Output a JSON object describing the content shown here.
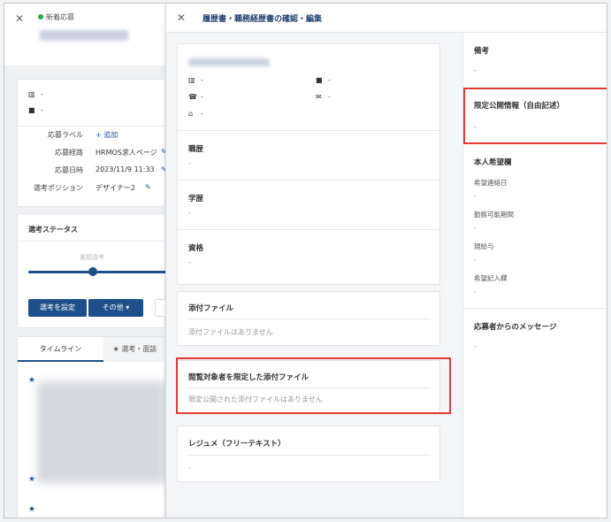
{
  "left_panel": {
    "new_label": "新着応募",
    "new_color": "#2eaa4a",
    "company": "-",
    "job": "-",
    "fields": [
      {
        "label": "応募ラベル",
        "value": "+ 追加"
      },
      {
        "label": "応募経路",
        "value": "HRMOS求人ページ"
      },
      {
        "label": "応募日時",
        "value": "2023/11/9 11:33"
      },
      {
        "label": "選考ポジション",
        "value": "デザイナー2"
      }
    ],
    "status_title": "選考ステータス",
    "stage_label": "書類選考",
    "set_stage_button": "選考を設定",
    "other_button": "その他",
    "timeline_tab": "タイムライン",
    "review_tab": "選考・面談"
  },
  "modal": {
    "title": "履歴書・職務経歴書の確認・編集",
    "contact": {
      "company": "-",
      "job": "-",
      "phone": "-",
      "email": "-",
      "address": "-"
    },
    "sections": [
      {
        "title": "職歴",
        "value": "-"
      },
      {
        "title": "学歴",
        "value": "-"
      },
      {
        "title": "資格",
        "value": "-"
      }
    ],
    "attachments": {
      "title": "添付ファイル",
      "empty": "添付ファイルはありません"
    },
    "restricted": {
      "title": "閲覧対象者を限定した添付ファイル",
      "empty": "限定公開された添付ファイルはありません"
    },
    "resume": {
      "title": "レジュメ（フリーテキスト）",
      "value": "-"
    },
    "right": {
      "notes_title": "備考",
      "notes_value": "-",
      "limited_title": "限定公開情報（自由記述）",
      "limited_value": "-",
      "wishes_title": "本人希望欄",
      "wishes": [
        {
          "label": "希望連絡日",
          "value": "-"
        },
        {
          "label": "勤務可能期間",
          "value": "-"
        },
        {
          "label": "現給与",
          "value": "-"
        },
        {
          "label": "希望記入欄",
          "value": "-"
        }
      ],
      "message_title": "応募者からのメッセージ",
      "message_value": "-"
    }
  },
  "colors": {
    "primary": "#1e4f8a",
    "highlight": "#e53935"
  }
}
